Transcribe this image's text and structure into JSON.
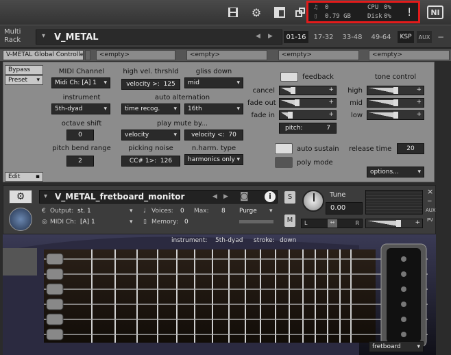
{
  "toolbar": {
    "save_icon": "save-icon",
    "gear_icon": "gear-icon",
    "layout_icon": "layout-icon",
    "resize_icon": "resize-icon",
    "status": {
      "midi_voices": "0",
      "memory": "0.79 GB",
      "cpu_label": "CPU",
      "cpu_value": "0%",
      "disk_label": "Disk",
      "disk_value": "0%",
      "warning": "!"
    },
    "logo": "NI"
  },
  "rack": {
    "label_line1": "Multi",
    "label_line2": "Rack",
    "name": "V_METAL",
    "tabs": [
      "01-16",
      "17-32",
      "33-48",
      "49-64"
    ],
    "ksp": "KSP",
    "aux": "AUX"
  },
  "script_tabs": [
    "V-METAL Global Controller",
    "<empty>",
    "<empty>",
    "<empty>",
    "<empty>"
  ],
  "panel": {
    "bypass": "Bypass",
    "preset": "Preset",
    "edit": "Edit",
    "midi_channel_label": "MIDI Channel",
    "midi_channel_value": "Midi Ch: [A] 1",
    "high_vel_label": "high vel. thrshld",
    "high_vel_prefix": "velocity >:",
    "high_vel_value": "125",
    "gliss_label": "gliss down",
    "gliss_value": "mid",
    "instrument_label": "instrument",
    "instrument_value": "5th-dyad",
    "auto_alt_label": "auto alternation",
    "auto_alt_mode": "time recog.",
    "auto_alt_note": "16th",
    "octave_label": "octave shift",
    "octave_value": "0",
    "play_mute_label": "play mute by...",
    "play_mute_mode": "velocity",
    "play_mute_prefix": "velocity <:",
    "play_mute_value": "70",
    "pitch_bend_label": "pitch bend range",
    "pitch_bend_value": "2",
    "picking_noise_label": "picking noise",
    "picking_noise_prefix": "CC# 1>:",
    "picking_noise_value": "126",
    "nharm_label": "n.harm. type",
    "nharm_value": "harmonics only",
    "feedback_label": "feedback",
    "cancel_label": "cancel",
    "fade_out_label": "fade out",
    "fade_in_label": "fade in",
    "pitch_prefix": "pitch:",
    "pitch_value": "7",
    "tone_label": "tone control",
    "high_label": "high",
    "mid_label": "mid",
    "low_label": "low",
    "auto_sustain_label": "auto sustain",
    "poly_mode_label": "poly mode",
    "release_label": "release time",
    "release_value": "20",
    "options_value": "options..."
  },
  "instrument": {
    "name": "V_METAL_fretboard_monitor",
    "output_label": "Output:",
    "output_value": "st. 1",
    "voices_label": "Voices:",
    "voices_value": "0",
    "max_label": "Max:",
    "max_value": "8",
    "purge": "Purge",
    "midi_label": "MIDI Ch:",
    "midi_value": "[A] 1",
    "memory_label": "Memory:",
    "memory_value": "0",
    "solo": "S",
    "mute": "M",
    "tune_label": "Tune",
    "tune_value": "0.00",
    "pan_l": "L",
    "pan_r": "R",
    "aux": "AUX",
    "pv": "PV",
    "close": "×"
  },
  "fretboard": {
    "instrument_label": "instrument:",
    "instrument_value": "5th-dyad",
    "stroke_label": "stroke:",
    "stroke_value": "down",
    "view_menu": "fretboard"
  }
}
